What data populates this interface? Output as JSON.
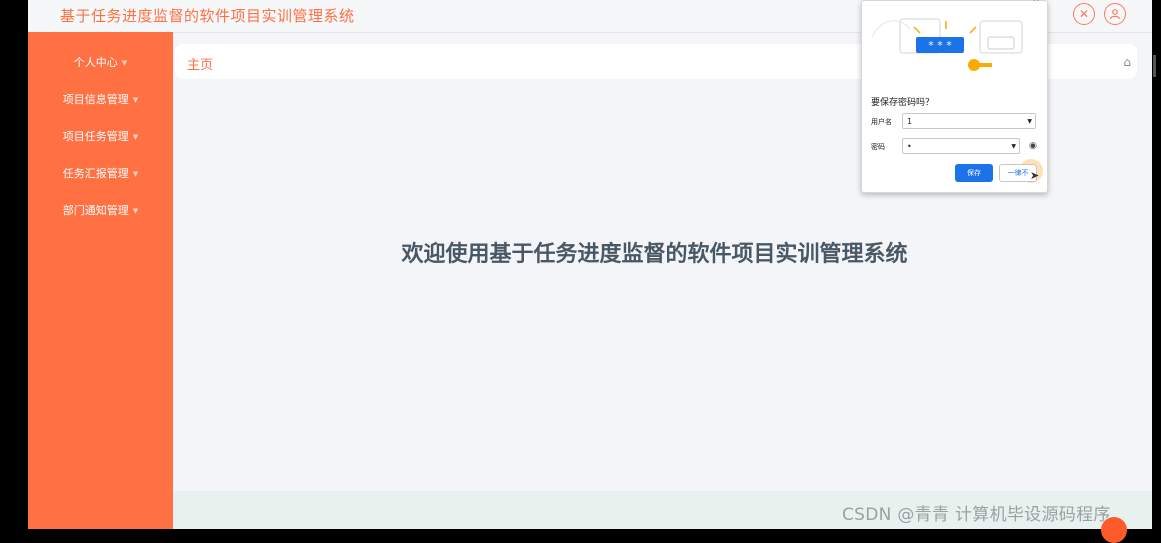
{
  "app": {
    "title": "基于任务进度监督的软件项目实训管理系统"
  },
  "topbar": {
    "close_icon_glyph": "✕",
    "user_icon_glyph": "👤"
  },
  "sidebar": {
    "items": [
      {
        "label": "个人中心"
      },
      {
        "label": "项目信息管理"
      },
      {
        "label": "项目任务管理"
      },
      {
        "label": "任务汇报管理"
      },
      {
        "label": "部门通知管理"
      }
    ]
  },
  "breadcrumb": {
    "current": "主页"
  },
  "main": {
    "welcome": "欢迎使用基于任务进度监督的软件项目实训管理系统"
  },
  "password_popup": {
    "title": "要保存密码吗？",
    "username_label": "用户名",
    "username_value": "1",
    "password_label": "密码",
    "password_value": "•",
    "save_label": "保存",
    "never_label": "一律不",
    "illustration_masked": "* * *"
  },
  "watermark": "CSDN @青青  计算机毕设源码程序",
  "colors": {
    "accent": "#ff7043",
    "sidebar_bg": "#ff7043",
    "save_button": "#1a73e8"
  }
}
